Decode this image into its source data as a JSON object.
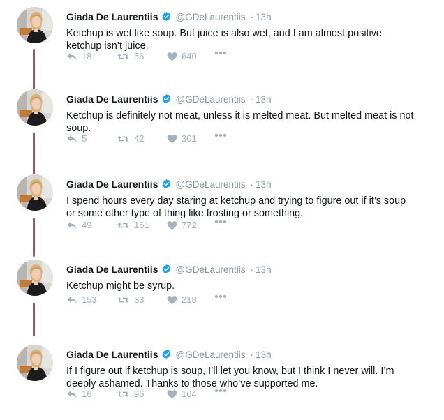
{
  "author": {
    "name": "Giada De Laurentiis",
    "handle": "@GDeLaurentiis",
    "separator": "·",
    "time": "13h",
    "verified": true
  },
  "icons": {
    "reply": "reply-icon",
    "retweet": "retweet-icon",
    "like": "heart-icon",
    "more": "more-icon",
    "verified": "verified-badge-icon"
  },
  "colors": {
    "thread_line": "#b04e5e",
    "verified_blue": "#1da1f2",
    "muted": "#8a949e"
  },
  "tweets": [
    {
      "text": "Ketchup is wet like soup. But juice is also wet, and I am almost positive ketchup isn’t juice.",
      "replies": "18",
      "retweets": "56",
      "likes": "640"
    },
    {
      "text": "Ketchup is definitely not meat, unless it is melted meat. But melted meat is not soup.",
      "replies": "5",
      "retweets": "42",
      "likes": "301"
    },
    {
      "text": "I spend hours every day staring at ketchup and trying to figure out if it’s soup or some other type of thing like frosting or something.",
      "replies": "49",
      "retweets": "161",
      "likes": "772"
    },
    {
      "text": "Ketchup might be syrup.",
      "replies": "153",
      "retweets": "33",
      "likes": "218"
    },
    {
      "text": "If I figure out if ketchup is soup, I’ll let you know, but I think I never will. I’m deeply ashamed. Thanks to those who’ve supported me.",
      "replies": "16",
      "retweets": "96",
      "likes": "164"
    }
  ]
}
